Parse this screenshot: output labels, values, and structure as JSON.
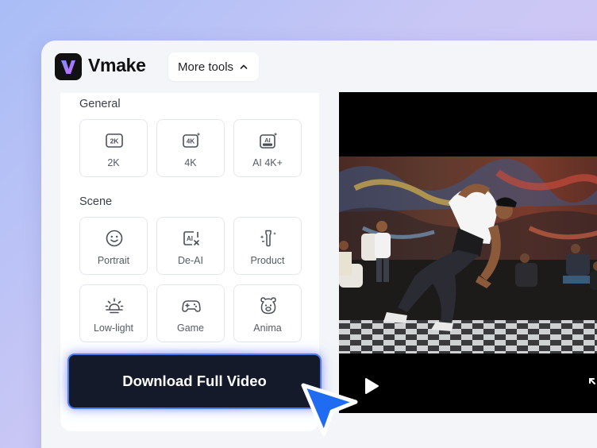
{
  "app": {
    "brand": "Vmake",
    "more_tools": "More tools"
  },
  "sidebar": {
    "sections": [
      {
        "title": "General",
        "items": [
          {
            "label": "2K",
            "icon": "2k-icon"
          },
          {
            "label": "4K",
            "icon": "4k-icon"
          },
          {
            "label": "AI 4K+",
            "icon": "ai-ultra-icon"
          }
        ]
      },
      {
        "title": "Scene",
        "items": [
          {
            "label": "Portrait",
            "icon": "smiley-face-icon"
          },
          {
            "label": "De-AI",
            "icon": "de-ai-icon"
          },
          {
            "label": "Product",
            "icon": "bottle-sparkle-icon"
          },
          {
            "label": "Low-light",
            "icon": "sunrise-icon"
          },
          {
            "label": "Game",
            "icon": "gamepad-icon"
          },
          {
            "label": "Anima",
            "icon": "bear-face-icon"
          }
        ]
      }
    ]
  },
  "download_button": "Download Full Video",
  "video": {
    "state": "paused",
    "controls": [
      "play-icon",
      "expand-icon"
    ]
  },
  "colors": {
    "brand_gradient": [
      "#6f7bff",
      "#c06cff"
    ],
    "button_bg": "#141a2a",
    "button_border": "#4c7cf2",
    "cursor": "#1f6bf2"
  }
}
